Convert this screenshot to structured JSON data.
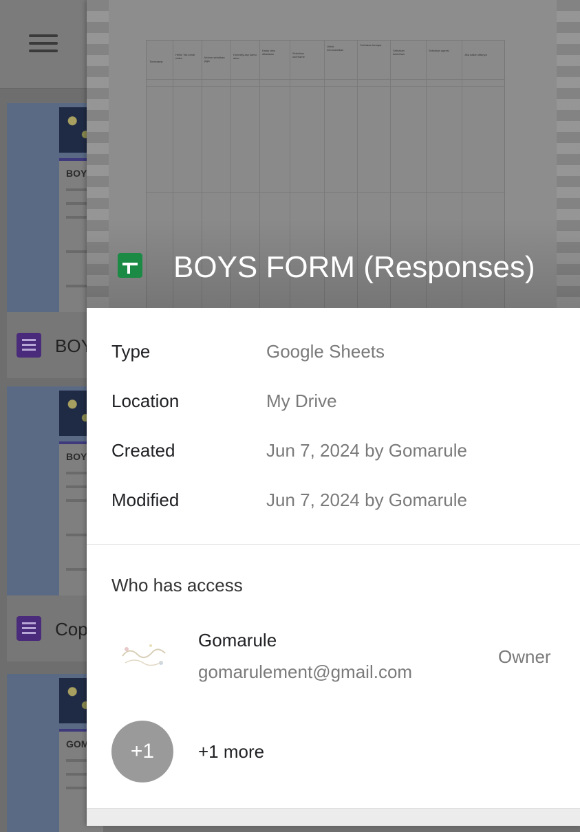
{
  "background": {
    "cards": [
      {
        "name": "BOY",
        "thumb_title": "BOYS"
      },
      {
        "name": "Cop",
        "thumb_title": "BOYS"
      },
      {
        "name": "",
        "thumb_title": "GOM"
      }
    ]
  },
  "details": {
    "file_title": "BOYS FORM (Responses)",
    "file_icon": "google-sheets-icon",
    "properties": [
      {
        "label": "Type",
        "value": "Google Sheets"
      },
      {
        "label": "Location",
        "value": "My Drive"
      },
      {
        "label": "Created",
        "value": "Jun 7, 2024 by Gomarule"
      },
      {
        "label": "Modified",
        "value": "Jun 7, 2024 by Gomarule"
      }
    ],
    "access": {
      "heading": "Who has access",
      "owner": {
        "name": "Gomarule",
        "email": "gomarulement@gmail.com",
        "role": "Owner"
      },
      "more": {
        "badge": "+1",
        "label": "+1 more"
      }
    }
  },
  "colors": {
    "sheets_green": "#1a8a45",
    "forms_purple": "#4a2a7a"
  }
}
